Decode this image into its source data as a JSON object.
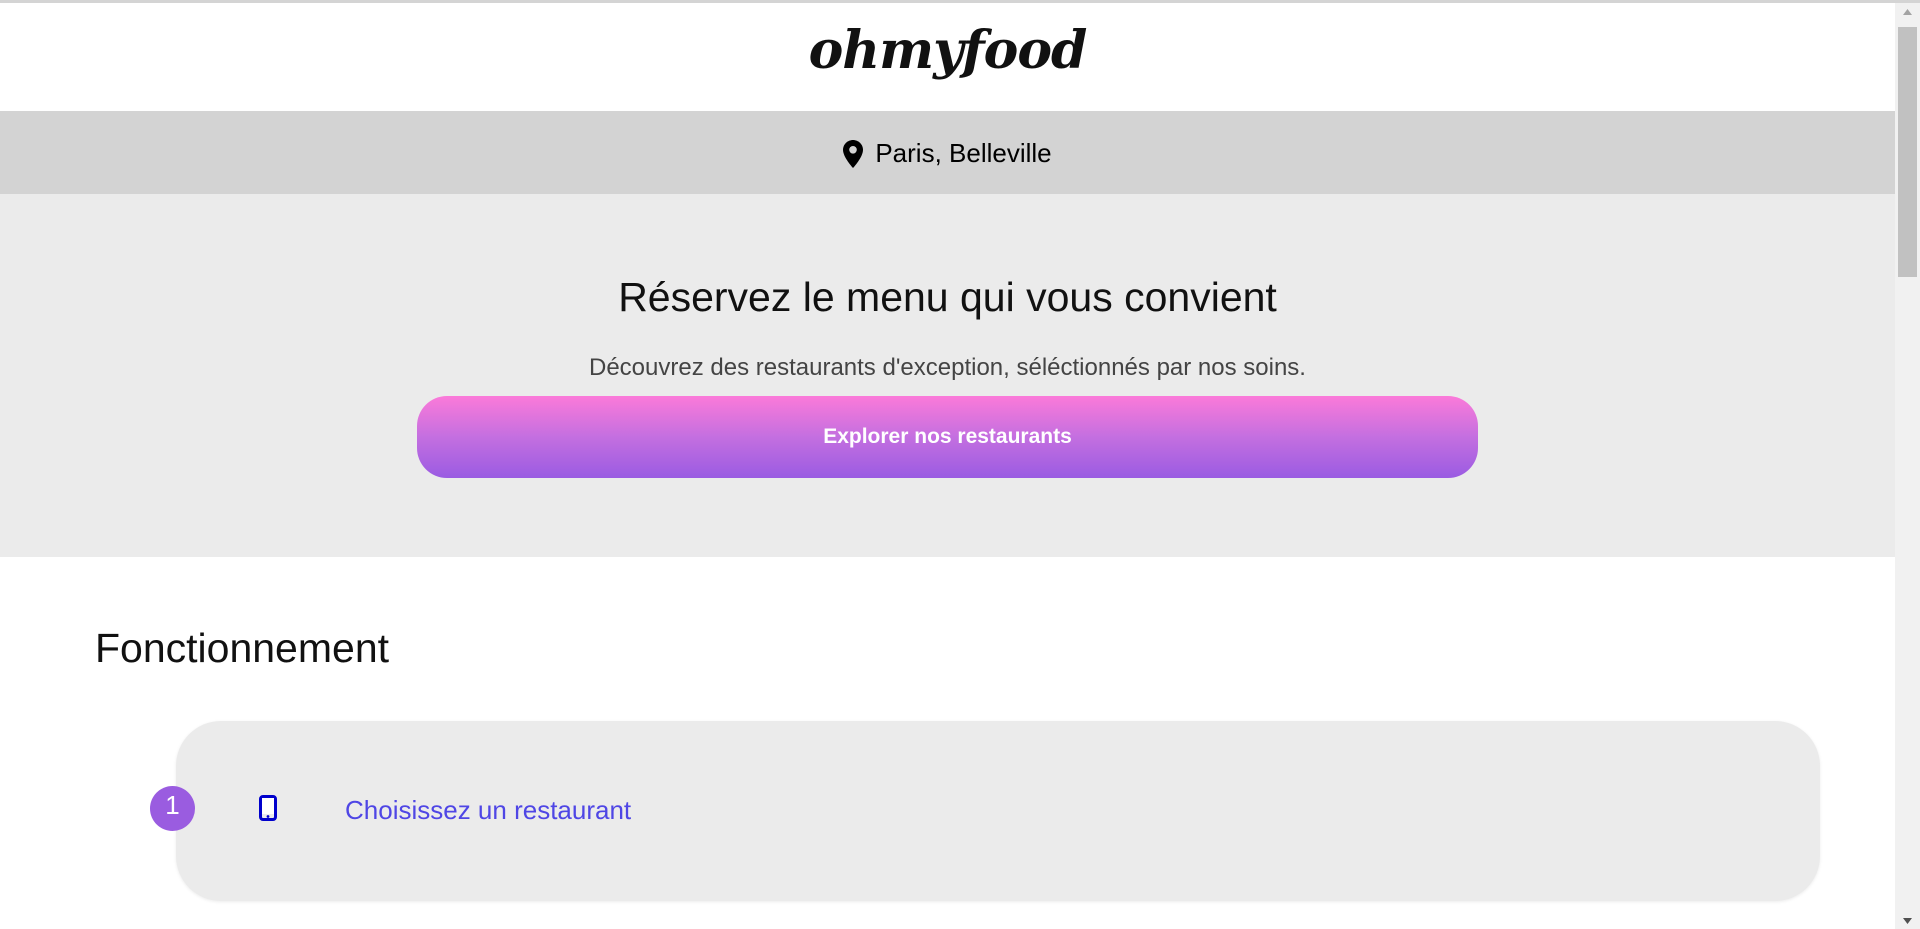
{
  "header": {
    "logo": "ohmyfood"
  },
  "location": {
    "icon": "map-pin-icon",
    "text": "Paris, Belleville"
  },
  "hero": {
    "title": "Réservez le menu qui vous convient",
    "subtitle": "Découvrez des restaurants d'exception, séléctionnés par nos soins.",
    "cta_label": "Explorer nos restaurants"
  },
  "how_it_works": {
    "title": "Fonctionnement",
    "steps": [
      {
        "number": "1",
        "icon": "mobile-phone-icon",
        "label": "Choisissez un restaurant"
      }
    ]
  },
  "colors": {
    "location_bar_bg": "#d3d3d3",
    "hero_bg": "#ebebeb",
    "cta_gradient_top": "#fb7ad9",
    "cta_gradient_bottom": "#9a5be2",
    "step_number_bg": "#9a5ce0",
    "step_link": "#4f46e5",
    "phone_icon": "#0000cc"
  }
}
